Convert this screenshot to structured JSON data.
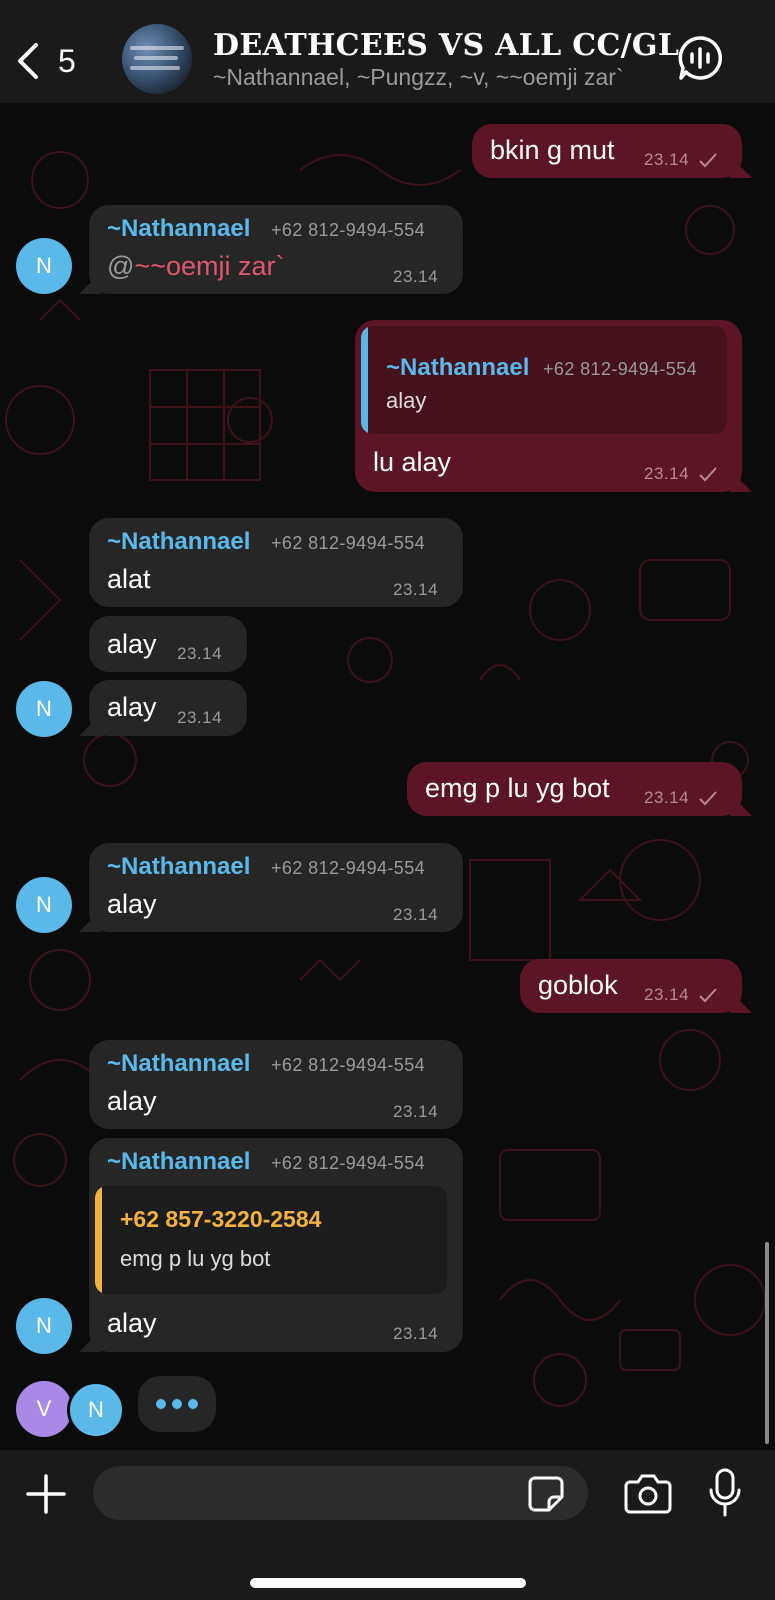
{
  "header": {
    "back_count": "5",
    "title": "DEATHCEES VS ALL CC/GL",
    "subtitle": "~Nathannael, ~Pungzz, ~v, ~~oemji zar`"
  },
  "messages": [
    {
      "dir": "out",
      "text": "bkin g mut",
      "time": "23.14"
    },
    {
      "dir": "in",
      "sender": "~Nathannael",
      "phone": "+62 812-9494-554",
      "mention_at": "@",
      "mention": "~~oemji zar`",
      "time": "23.14",
      "avatar": "N"
    },
    {
      "dir": "out",
      "quote_sender": "~Nathannael",
      "quote_phone": "+62 812-9494-554",
      "quote_text": "alay",
      "text": "lu alay",
      "time": "23.14"
    },
    {
      "dir": "in",
      "sender": "~Nathannael",
      "phone": "+62 812-9494-554",
      "text": "alat",
      "time": "23.14"
    },
    {
      "dir": "in",
      "text": "alay",
      "time": "23.14"
    },
    {
      "dir": "in",
      "text": "alay",
      "time": "23.14",
      "avatar": "N"
    },
    {
      "dir": "out",
      "text": "emg p lu yg bot",
      "time": "23.14"
    },
    {
      "dir": "in",
      "sender": "~Nathannael",
      "phone": "+62 812-9494-554",
      "text": "alay",
      "time": "23.14",
      "avatar": "N"
    },
    {
      "dir": "out",
      "text": "goblok",
      "time": "23.14"
    },
    {
      "dir": "in",
      "sender": "~Nathannael",
      "phone": "+62 812-9494-554",
      "text": "alay",
      "time": "23.14"
    },
    {
      "dir": "in",
      "sender": "~Nathannael",
      "phone": "+62 812-9494-554",
      "quote_sender": "+62 857-3220-2584",
      "quote_text": "emg p lu yg bot",
      "text": "alay",
      "time": "23.14",
      "avatar": "N"
    }
  ],
  "typing": {
    "avatars": [
      "V",
      "N"
    ]
  },
  "colors": {
    "incoming": "#262626",
    "outgoing": "#5c1526",
    "sender": "#5ab9e8",
    "mention": "#e0566e",
    "quote_bar_in": "#f2b23c"
  },
  "icons": [
    "chevron-left-icon",
    "group-avatar-image",
    "voice-call-icon",
    "plus-icon",
    "sticker-icon",
    "camera-icon",
    "microphone-icon",
    "checkmark-icon"
  ]
}
